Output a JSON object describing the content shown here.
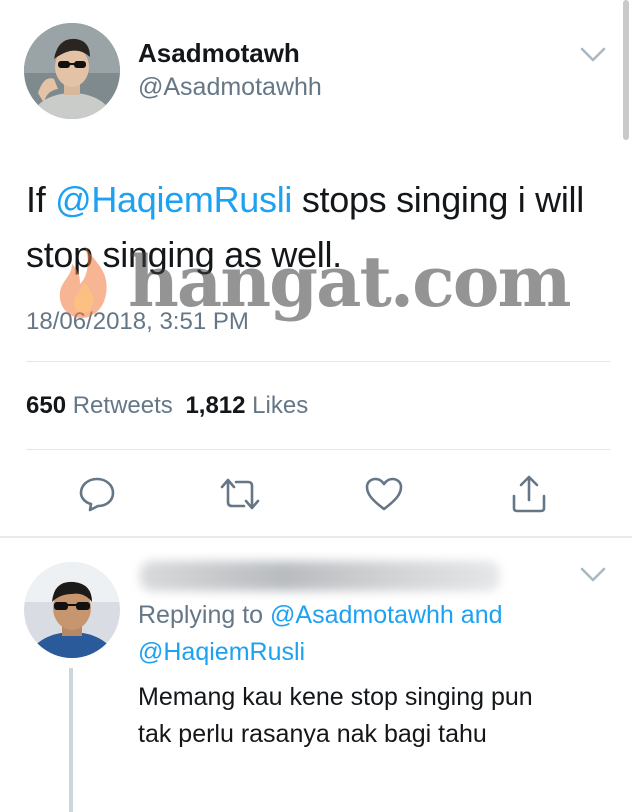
{
  "tweet": {
    "author_name": "Asadmotawh",
    "author_handle": "@Asadmotawhh",
    "text_before": "If ",
    "mention": "@HaqiemRusli",
    "text_after": " stops singing i will stop singing as well.",
    "timestamp": "18/06/2018, 3:51 PM",
    "retweets_count": "650",
    "retweets_label": "Retweets",
    "likes_count": "1,812",
    "likes_label": "Likes"
  },
  "actions": {
    "reply_icon": "reply-icon",
    "retweet_icon": "retweet-icon",
    "like_icon": "heart-icon",
    "share_icon": "share-icon"
  },
  "reply": {
    "replying_to_label": "Replying to",
    "replying_to_user1": "@Asadmotawhh",
    "and_label": "and",
    "replying_to_user2": "@HaqiemRusli",
    "text": "Memang kau kene stop singing pun tak perlu rasanya nak bagi tahu"
  },
  "watermark": {
    "text": "hangat.com"
  },
  "colors": {
    "link": "#1da1f2",
    "secondary_text": "#657786",
    "divider": "#e1e8ed"
  }
}
